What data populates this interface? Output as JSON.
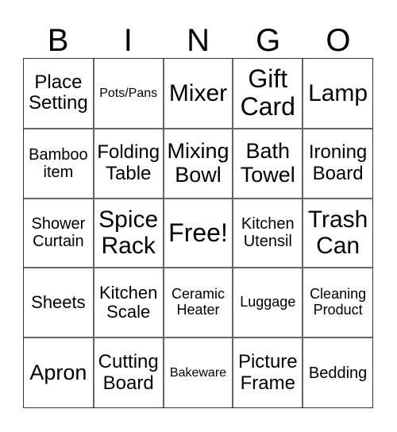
{
  "header": [
    "B",
    "I",
    "N",
    "G",
    "O"
  ],
  "cells": [
    "Place Setting",
    "Pots/Pans",
    "Mixer",
    "Gift Card",
    "Lamp",
    "Bamboo item",
    "Folding Table",
    "Mixing Bowl",
    "Bath Towel",
    "Ironing Board",
    "Shower Curtain",
    "Spice Rack",
    "Free!",
    "Kitchen Utensil",
    "Trash Can",
    "Sheets",
    "Kitchen Scale",
    "Ceramic Heater",
    "Luggage",
    "Cleaning Product",
    "Apron",
    "Cutting Board",
    "Bakeware",
    "Picture Frame",
    "Bedding"
  ]
}
